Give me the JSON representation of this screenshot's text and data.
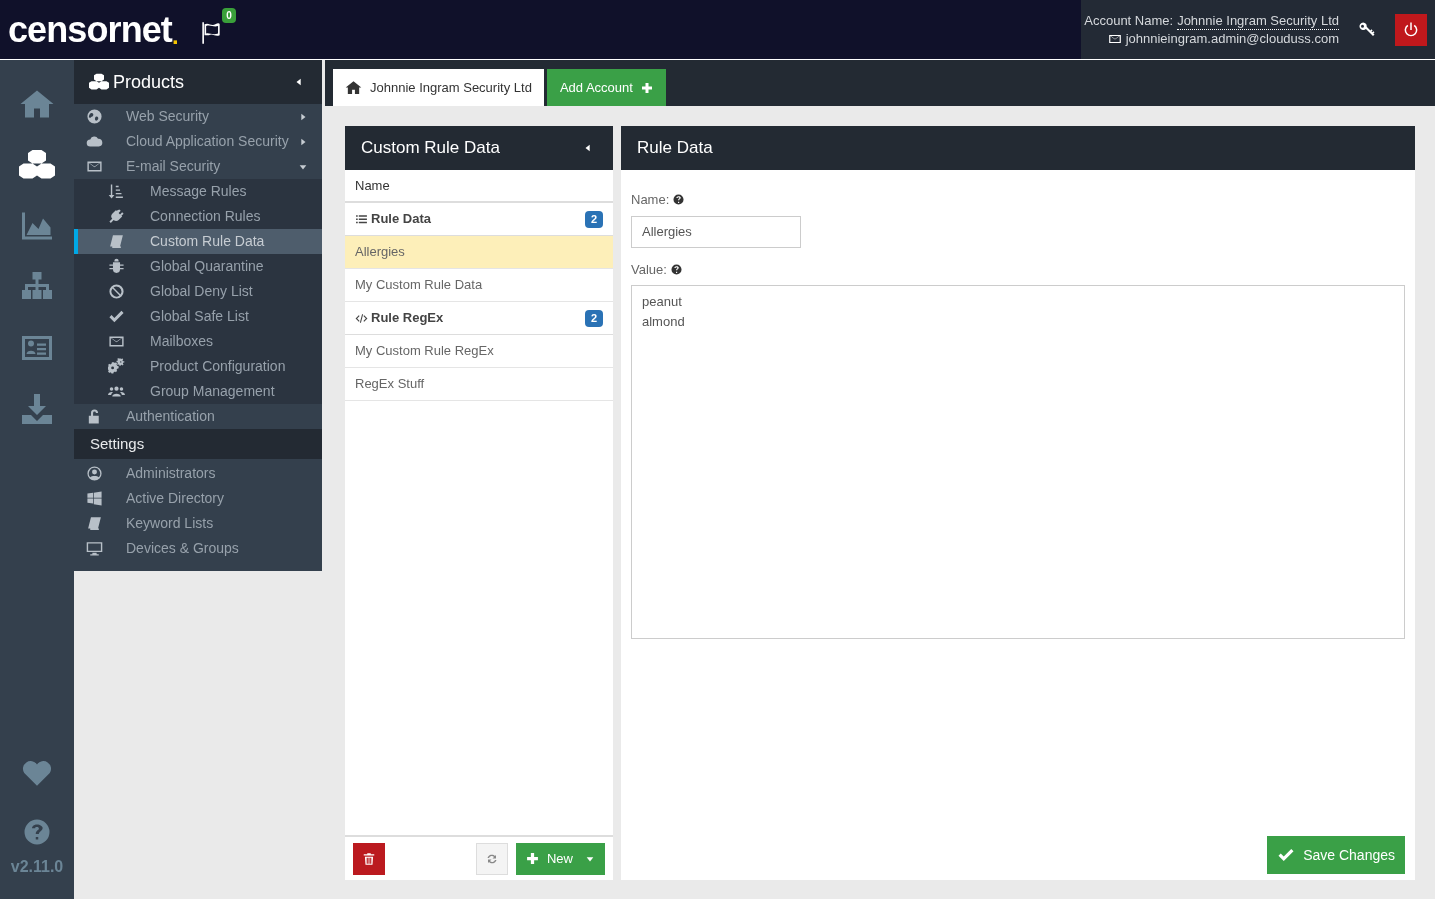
{
  "header": {
    "logo": "censornet",
    "logo_dot": ".",
    "notifications": "0",
    "account_label": "Account Name:",
    "account_name": "Johnnie Ingram Security Ltd",
    "email": "johnnieingram.admin@clouduss.com"
  },
  "rail": {
    "items": [
      {
        "selected": false
      },
      {
        "selected": true
      },
      {
        "selected": false
      },
      {
        "selected": false
      },
      {
        "selected": false
      },
      {
        "selected": false
      }
    ],
    "version": "v2.11.0"
  },
  "menu": {
    "title": "Products",
    "items": [
      {
        "label": "Web Security",
        "expanded": false,
        "selected": false
      },
      {
        "label": "Cloud Application Security",
        "expanded": false,
        "selected": false
      },
      {
        "label": "E-mail Security",
        "expanded": true,
        "selected": false,
        "children": [
          {
            "label": "Message Rules",
            "selected": false
          },
          {
            "label": "Connection Rules",
            "selected": false
          },
          {
            "label": "Custom Rule Data",
            "selected": true
          },
          {
            "label": "Global Quarantine",
            "selected": false
          },
          {
            "label": "Global Deny List",
            "selected": false
          },
          {
            "label": "Global Safe List",
            "selected": false
          },
          {
            "label": "Mailboxes",
            "selected": false
          },
          {
            "label": "Product Configuration",
            "selected": false
          },
          {
            "label": "Group Management",
            "selected": false
          }
        ]
      },
      {
        "label": "Authentication",
        "selected": false
      }
    ],
    "settings_title": "Settings",
    "settings_items": [
      {
        "label": "Administrators",
        "selected": false
      },
      {
        "label": "Active Directory",
        "selected": false
      },
      {
        "label": "Keyword Lists",
        "selected": false
      },
      {
        "label": "Devices & Groups",
        "selected": false
      }
    ]
  },
  "tabs": [
    {
      "label": "Johnnie Ingram Security Ltd",
      "selected": true
    }
  ],
  "add_account": "Add Account",
  "list_panel": {
    "title": "Custom Rule Data",
    "column": "Name",
    "groups": [
      {
        "label": "Rule Data",
        "count": "2",
        "items": [
          {
            "label": "Allergies",
            "selected": true
          },
          {
            "label": "My Custom Rule Data",
            "selected": false
          }
        ]
      },
      {
        "label": "Rule RegEx",
        "count": "2",
        "items": [
          {
            "label": "My Custom Rule RegEx",
            "selected": false
          },
          {
            "label": "RegEx Stuff",
            "selected": false
          }
        ]
      }
    ],
    "new_button": "New"
  },
  "detail_panel": {
    "title": "Rule Data",
    "name_label": "Name:",
    "name_value": "Allergies",
    "value_label": "Value:",
    "value_text": "peanut\nalmond",
    "save_button": "Save Changes"
  }
}
